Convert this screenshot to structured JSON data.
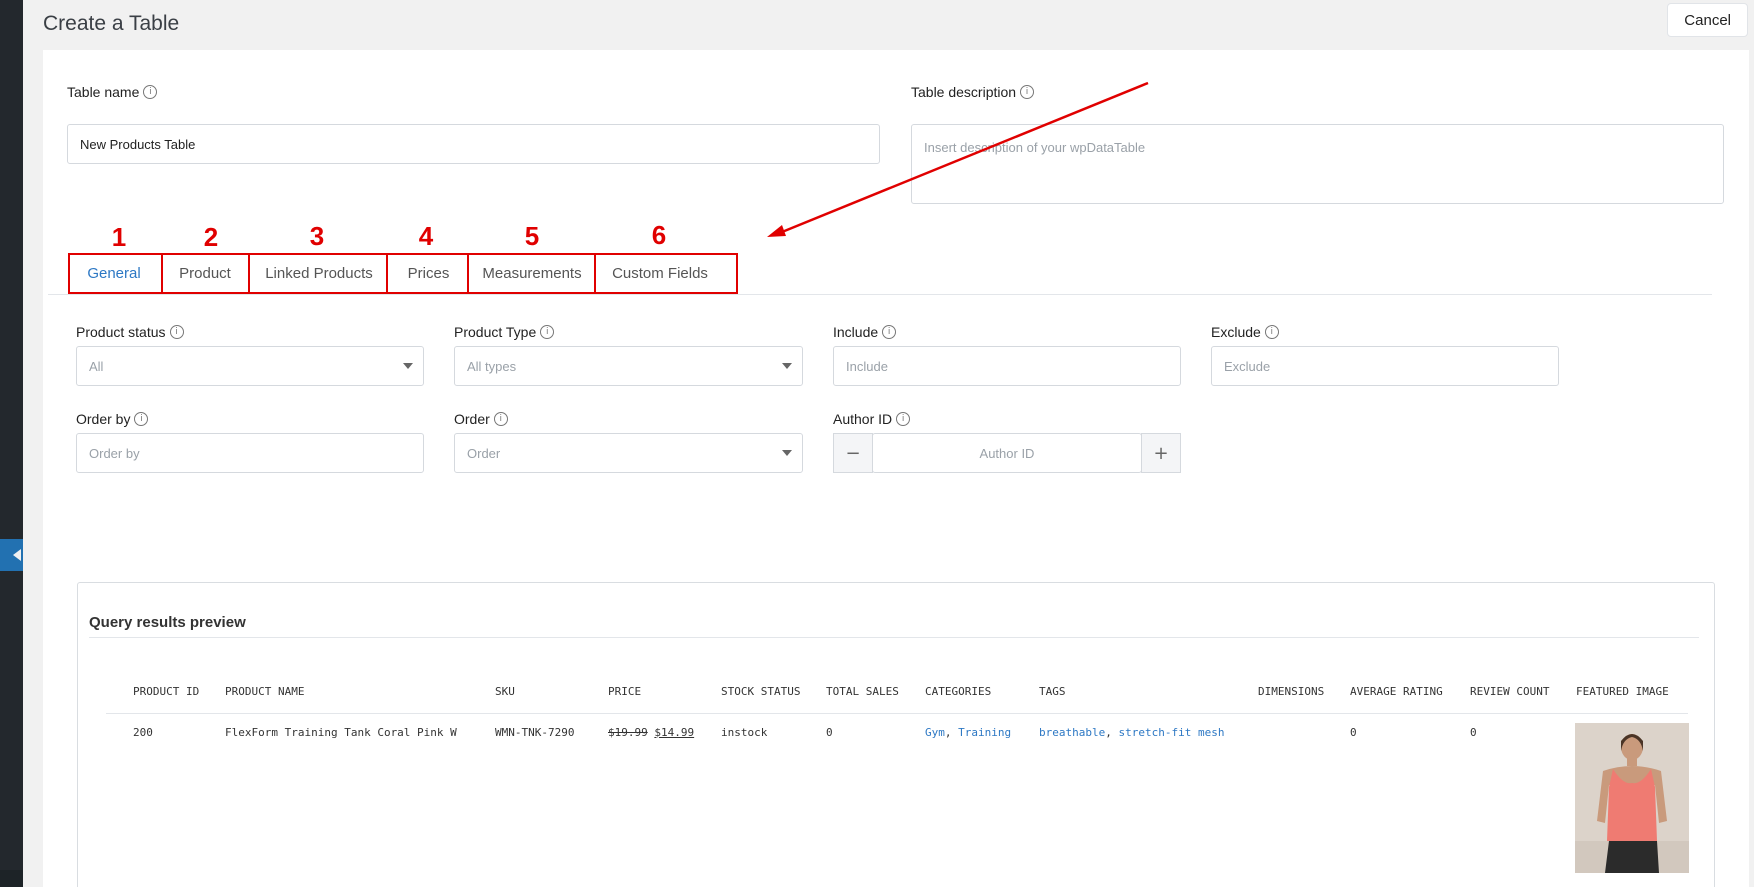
{
  "page": {
    "title": "Create a Table",
    "cancel_label": "Cancel"
  },
  "form": {
    "table_name_label": "Table name",
    "table_name_value": "New Products Table",
    "table_description_label": "Table description",
    "table_description_placeholder": "Insert description of your wpDataTable"
  },
  "tabs": [
    {
      "number": "1",
      "label": "General",
      "active": true
    },
    {
      "number": "2",
      "label": "Product",
      "active": false
    },
    {
      "number": "3",
      "label": "Linked Products",
      "active": false
    },
    {
      "number": "4",
      "label": "Prices",
      "active": false
    },
    {
      "number": "5",
      "label": "Measurements",
      "active": false
    },
    {
      "number": "6",
      "label": "Custom Fields",
      "active": false
    }
  ],
  "filters": {
    "product_status": {
      "label": "Product status",
      "value": "All"
    },
    "product_type": {
      "label": "Product Type",
      "value": "All types"
    },
    "include": {
      "label": "Include",
      "placeholder": "Include"
    },
    "exclude": {
      "label": "Exclude",
      "placeholder": "Exclude"
    },
    "order_by": {
      "label": "Order by",
      "placeholder": "Order by"
    },
    "order": {
      "label": "Order",
      "value": "Order"
    },
    "author_id": {
      "label": "Author ID",
      "placeholder": "Author ID",
      "minus": "−",
      "plus": "+"
    }
  },
  "preview": {
    "title": "Query results preview",
    "columns": [
      "PRODUCT ID",
      "PRODUCT NAME",
      "SKU",
      "PRICE",
      "STOCK STATUS",
      "TOTAL SALES",
      "CATEGORIES",
      "TAGS",
      "DIMENSIONS",
      "AVERAGE RATING",
      "REVIEW COUNT",
      "FEATURED IMAGE"
    ],
    "row": {
      "product_id": "200",
      "product_name": "FlexForm Training Tank Coral Pink W",
      "sku": "WMN-TNK-7290",
      "regular_price": "$19.99",
      "sale_price": "$14.99",
      "stock_status": "instock",
      "total_sales": "0",
      "categories": [
        "Gym",
        "Training"
      ],
      "tags": [
        "breathable",
        "stretch-fit mesh"
      ],
      "dimensions": "",
      "average_rating": "0",
      "review_count": "0"
    }
  },
  "colors": {
    "accent": "#2d78c4",
    "annotation": "#e00000"
  }
}
